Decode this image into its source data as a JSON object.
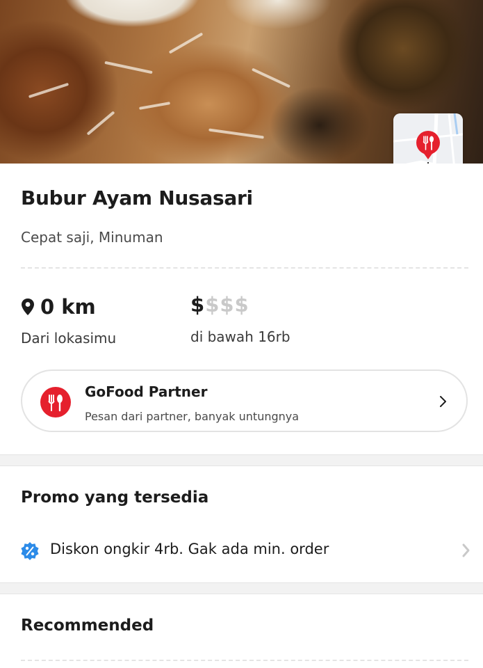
{
  "restaurant": {
    "name": "Bubur Ayam Nusasari",
    "categories": "Cepat saji, Minuman"
  },
  "hero_image": {
    "icon": "restaurant-location-map-icon"
  },
  "distance": {
    "value": "0 km",
    "label": "Dari lokasimu",
    "icon": "location-pin-icon"
  },
  "price": {
    "active": "$",
    "inactive": "$$$",
    "level": 1,
    "max_level": 4,
    "label": "di bawah 16rb"
  },
  "partner": {
    "title": "GoFood Partner",
    "subtitle": "Pesan dari partner, banyak untungnya",
    "icon": "fork-spoon-icon",
    "accent": "#e5202d"
  },
  "promo": {
    "heading": "Promo yang tersedia",
    "items": [
      {
        "text": "Diskon ongkir 4rb. Gak ada min. order",
        "icon": "discount-badge-icon",
        "accent": "#2c8be8"
      }
    ]
  },
  "recommended": {
    "heading": "Recommended"
  }
}
